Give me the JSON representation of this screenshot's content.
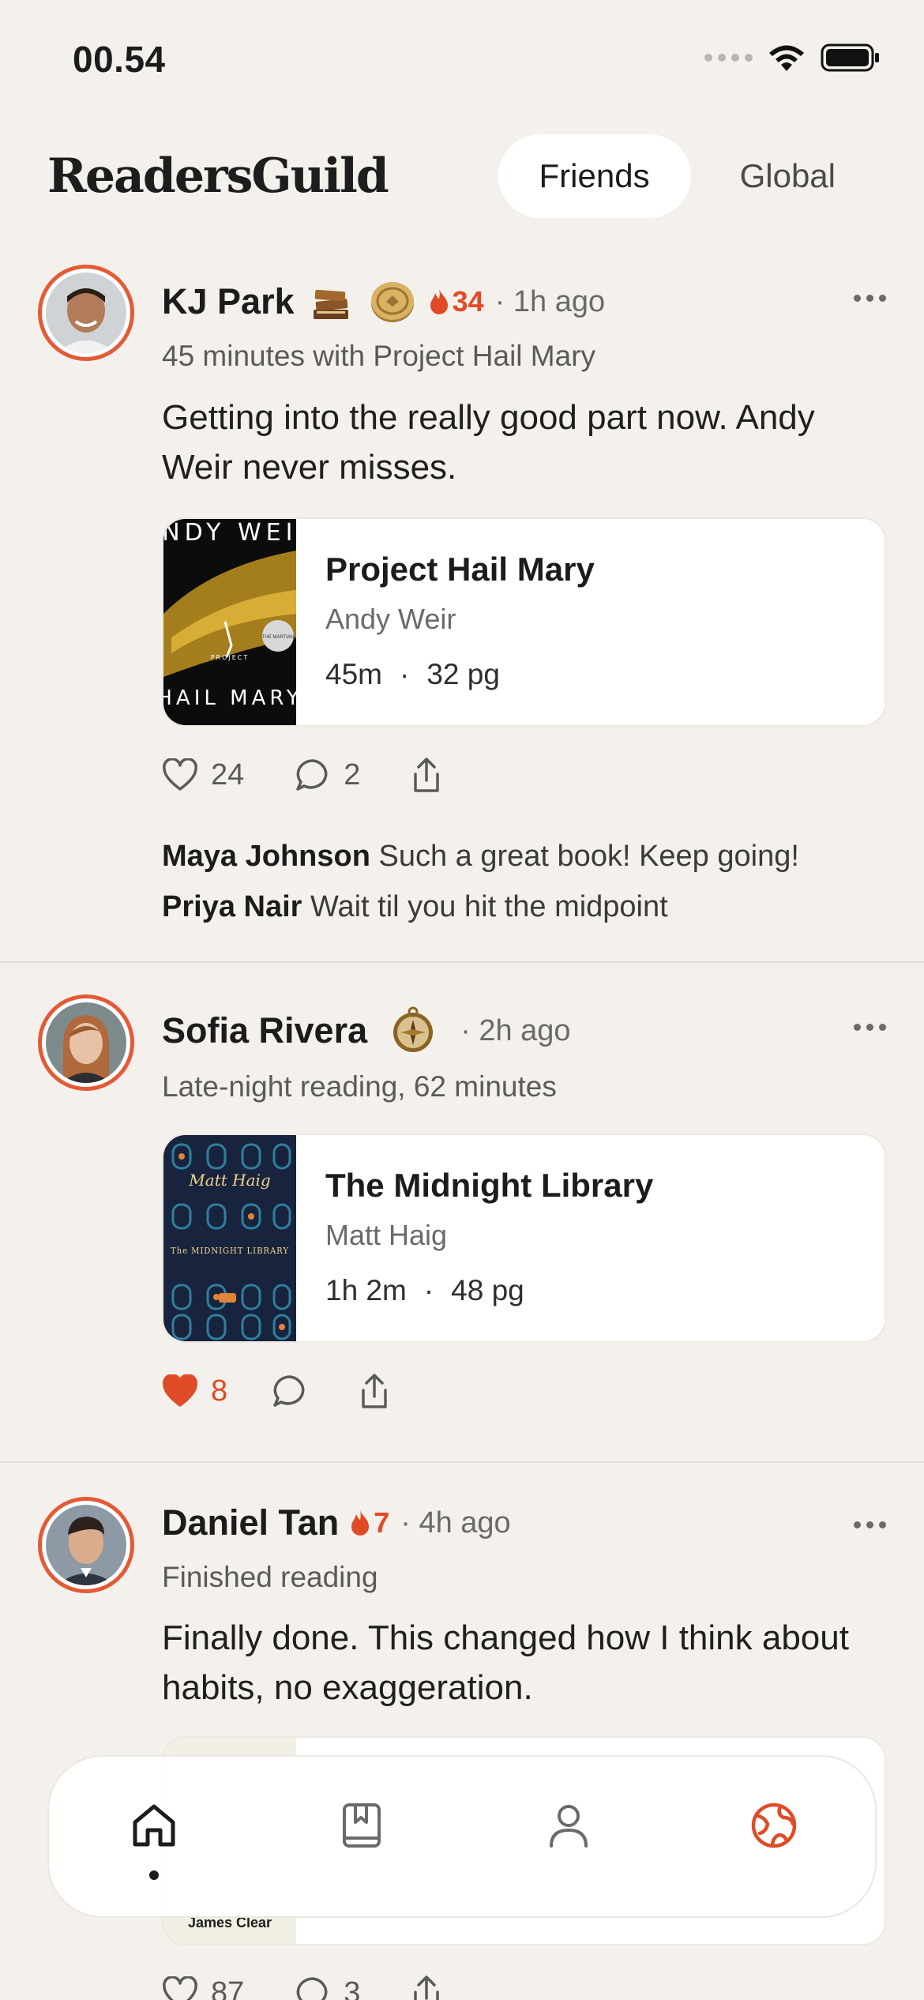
{
  "status_bar": {
    "time": "00.54"
  },
  "header": {
    "app_name": "ReadersGuild",
    "tabs": [
      {
        "label": "Friends",
        "active": true
      },
      {
        "label": "Global",
        "active": false
      }
    ]
  },
  "posts": [
    {
      "user": "KJ Park",
      "badges": [
        "book-stack-badge",
        "gold-coin-badge"
      ],
      "streak": "34",
      "time_ago": "· 1h ago",
      "activity": "45 minutes with Project Hail Mary",
      "caption": "Getting into the really good part now. Andy Weir never misses.",
      "book": {
        "title": "Project Hail Mary",
        "author": "Andy Weir",
        "duration": "45m",
        "sep": "·",
        "pages": "32 pg",
        "cover_text_top": "ANDY WEIR",
        "cover_text_bottom": "HAIL MARY",
        "cover_small": "PROJECT",
        "cover_seal": "THE MARTIAN"
      },
      "likes": "24",
      "comment_count": "2",
      "liked": false,
      "comments": [
        {
          "author": "Maya Johnson",
          "text": "Such a great book! Keep going!"
        },
        {
          "author": "Priya Nair",
          "text": "Wait til you hit the midpoint"
        }
      ]
    },
    {
      "user": "Sofia Rivera",
      "badges": [
        "compass-badge"
      ],
      "time_ago": "· 2h ago",
      "activity": "Late-night reading, 62 minutes",
      "book": {
        "title": "The Midnight Library",
        "author": "Matt Haig",
        "duration": "1h 2m",
        "sep": "·",
        "pages": "48 pg",
        "cover_text_top": "Matt Haig",
        "cover_text_bottom": "The MIDNIGHT LIBRARY"
      },
      "likes": "8",
      "liked": true
    },
    {
      "user": "Daniel Tan",
      "streak": "7",
      "time_ago": "· 4h ago",
      "activity": "Finished reading",
      "caption": "Finally done. This changed how I think about habits, no exaggeration.",
      "book": {
        "cover_text_bottom": "James Clear"
      },
      "likes": "87",
      "comment_count": "3"
    }
  ],
  "tab_bar": {
    "items": [
      {
        "icon": "home-icon",
        "active": true
      },
      {
        "icon": "bookmark-book-icon",
        "active": false
      },
      {
        "icon": "profile-icon",
        "active": false
      },
      {
        "icon": "globe-icon",
        "active": false,
        "accent": "#e04b27"
      }
    ]
  },
  "colors": {
    "accent": "#e04b27",
    "background": "#f4f1ec",
    "card": "#ffffff"
  }
}
